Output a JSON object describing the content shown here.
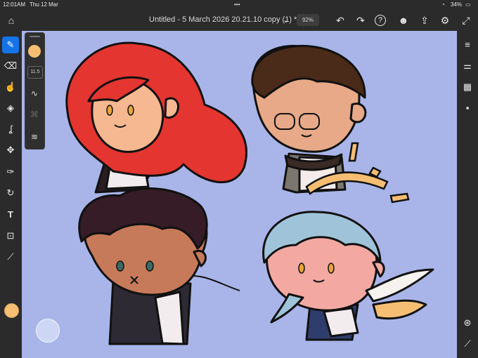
{
  "status_bar": {
    "time": "12:01AM",
    "date": "Thu 12 Mar",
    "dots": "•••",
    "battery": "34%"
  },
  "document": {
    "title": "Untitled - 5 March 2026 20.21.10 copy (1) *",
    "title_chevron": "⌄",
    "zoom": "92%"
  },
  "top_icons": {
    "home": "⌂",
    "undo": "↶",
    "redo": "↷",
    "help": "?",
    "account": "☻",
    "share": "⇪",
    "settings": "⚙",
    "fullscreen": "⤢"
  },
  "left_tools": [
    {
      "name": "brush-tool",
      "glyph": "✎",
      "active": true
    },
    {
      "name": "eraser-tool",
      "glyph": "⌫"
    },
    {
      "name": "smudge-tool",
      "glyph": "☝"
    },
    {
      "name": "fill-tool",
      "glyph": "◈"
    },
    {
      "name": "liquify-tool",
      "glyph": "ʆ"
    },
    {
      "name": "transform-tool",
      "glyph": "✥"
    },
    {
      "name": "lasso-tool",
      "glyph": "✑"
    },
    {
      "name": "shape-tool",
      "glyph": "↻"
    },
    {
      "name": "text-tool",
      "glyph": "T"
    },
    {
      "name": "image-tool",
      "glyph": "⊡"
    },
    {
      "name": "eyedropper-tool",
      "glyph": "⟋"
    }
  ],
  "brush_panel": {
    "size": "11.5",
    "smoothing_glyph": "∿",
    "pressure_glyph": "⌘",
    "settings_glyph": "≋"
  },
  "right_tools": {
    "layers": "≡",
    "adjust": "⚌",
    "grid": "▦",
    "comments": "▪",
    "shapes": "⊛",
    "ruler": "⟋"
  },
  "colors": {
    "primary": "#f5be73",
    "accent": "#1473e6",
    "canvas": "#a9b5e9"
  }
}
